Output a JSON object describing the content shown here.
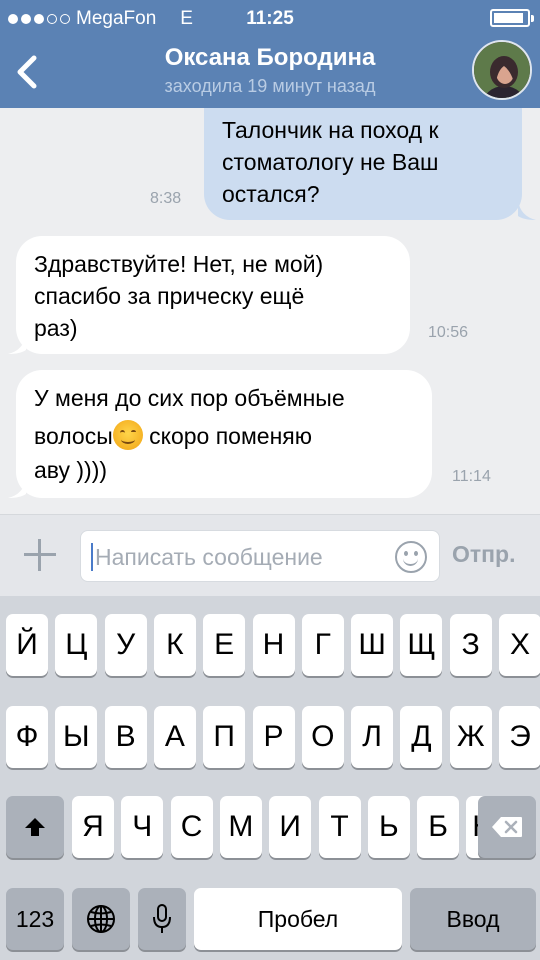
{
  "status_bar": {
    "carrier": "MegaFon",
    "network": "E",
    "time": "11:25",
    "battery_level": 0.92
  },
  "header": {
    "back_icon": "chevron-left-icon",
    "contact_name": "Оксана Бородина",
    "last_seen": "заходила 19 минут назад"
  },
  "messages": [
    {
      "direction": "outgoing",
      "text": "Талончик на поход к\nстоматологу не Ваш\nостался?",
      "time": "8:38"
    },
    {
      "direction": "incoming",
      "text": "Здравствуйте! Нет, не мой)\nспасибо за прическу ещё\nраз)",
      "time": "10:56"
    },
    {
      "direction": "incoming",
      "text_line1": "У меня до сих пор объёмные",
      "text_line2_before_emoji": "волосы",
      "emoji": "smiling-face-emoji",
      "text_line2_after_emoji": " скоро поменяю",
      "text_line3": "аву ))))",
      "time": "11:14"
    }
  ],
  "input_bar": {
    "attach_icon": "plus-icon",
    "placeholder": "Написать сообщение",
    "emoji_icon": "smiley-icon",
    "send_label": "Отпр."
  },
  "keyboard": {
    "row1": [
      "Й",
      "Ц",
      "У",
      "К",
      "Е",
      "Н",
      "Г",
      "Ш",
      "Щ",
      "З",
      "Х"
    ],
    "row2": [
      "Ф",
      "Ы",
      "В",
      "А",
      "П",
      "Р",
      "О",
      "Л",
      "Д",
      "Ж",
      "Э"
    ],
    "row3": [
      "Я",
      "Ч",
      "С",
      "М",
      "И",
      "Т",
      "Ь",
      "Б",
      "Ю"
    ],
    "shift_icon": "shift-icon",
    "delete_icon": "backspace-icon",
    "numbers_label": "123",
    "globe_icon": "globe-icon",
    "mic_icon": "microphone-icon",
    "space_label": "Пробел",
    "return_label": "Ввод"
  }
}
